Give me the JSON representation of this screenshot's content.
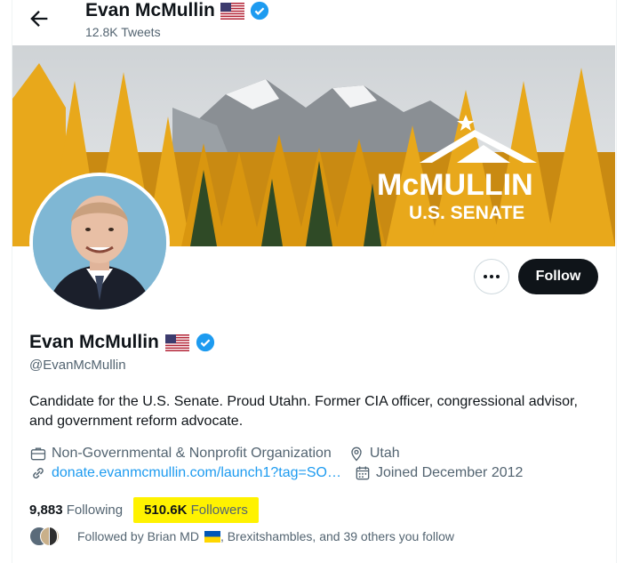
{
  "header": {
    "title": "Evan McMullin",
    "tweet_count": "12.8K Tweets"
  },
  "banner": {
    "logo_line1": "McMULLIN",
    "logo_line2": "U.S. SENATE"
  },
  "actions": {
    "follow_label": "Follow"
  },
  "profile": {
    "name": "Evan McMullin",
    "handle": "@EvanMcMullin",
    "bio": "Candidate for the U.S. Senate. Proud Utahn. Former CIA officer, congressional advisor, and government reform advocate.",
    "category": "Non-Governmental & Nonprofit Organization",
    "location": "Utah",
    "website": "donate.evanmcmullin.com/launch1?tag=SO…",
    "joined": "Joined December 2012"
  },
  "stats": {
    "following_count": "9,883",
    "following_label": "Following",
    "followers_count": "510.6K",
    "followers_label": "Followers"
  },
  "followed_by": {
    "prefix": "Followed by Brian MD",
    "suffix": ", Brexitshambles, and 39 others you follow"
  },
  "colors": {
    "accent": "#1d9bf0",
    "highlight": "#fff200",
    "follow_button": "#0f1419",
    "secondary_text": "#536471"
  },
  "icons": [
    "back-arrow-icon",
    "us-flag-icon",
    "verified-badge-icon",
    "more-icon",
    "briefcase-icon",
    "location-pin-icon",
    "link-icon",
    "calendar-icon",
    "ukraine-flag-icon"
  ]
}
